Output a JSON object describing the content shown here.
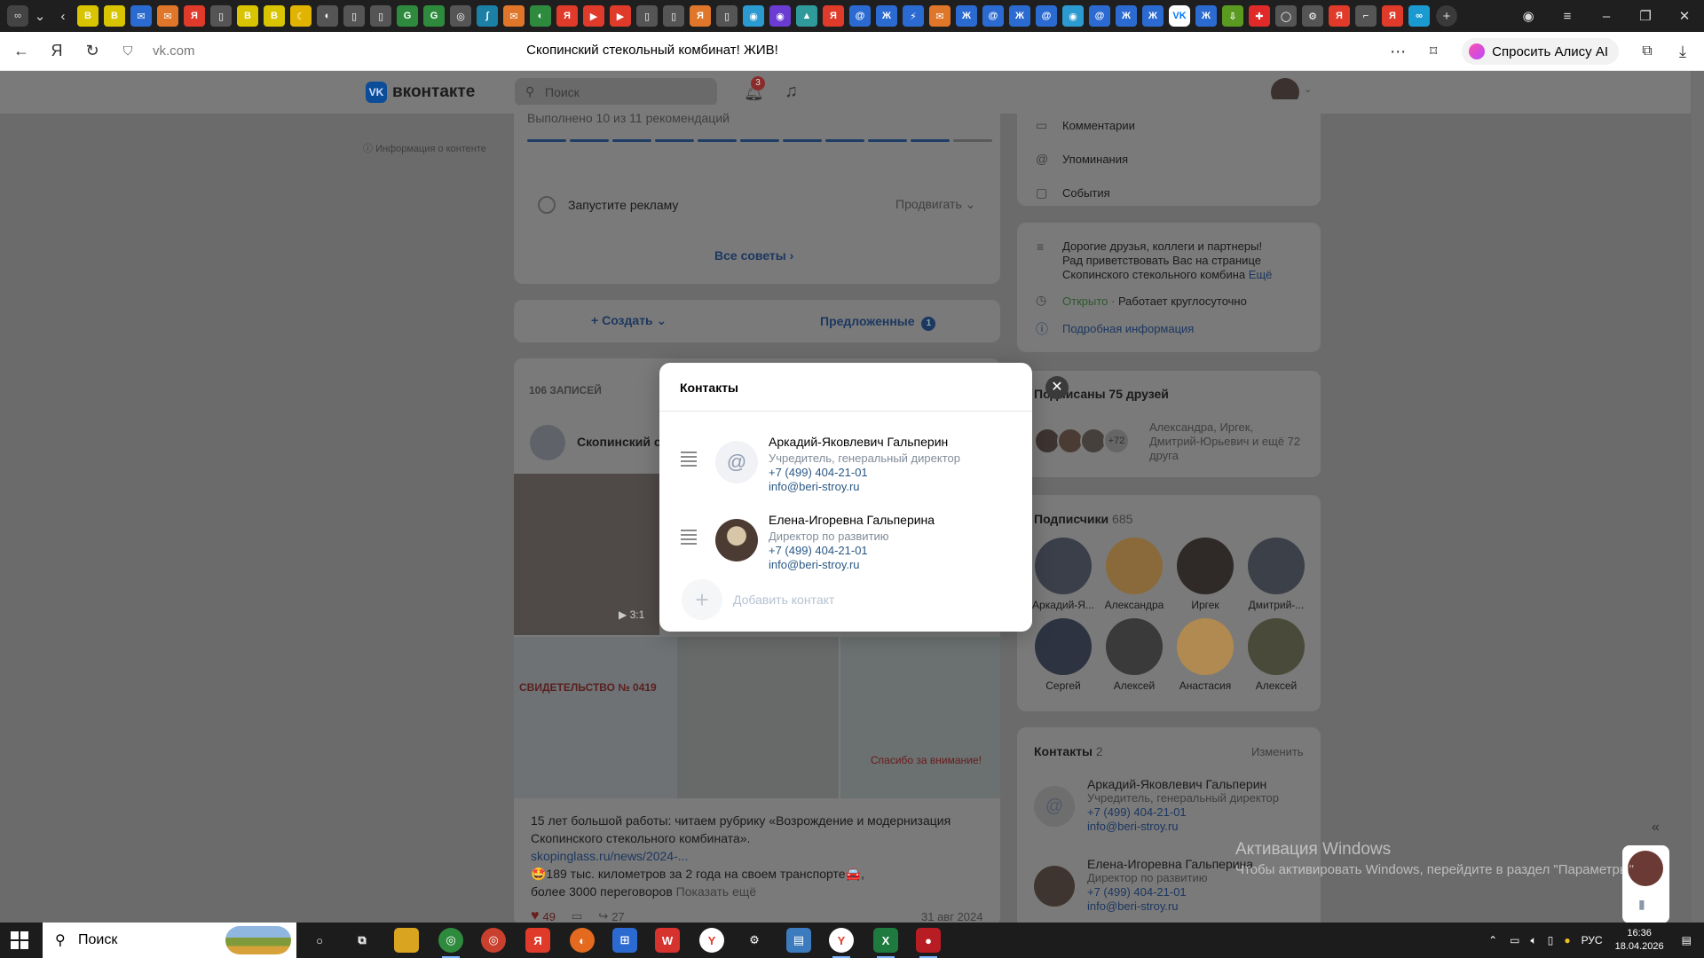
{
  "browser": {
    "domain": "vk.com",
    "page_title": "Скопинский стекольный комбинат! ЖИВ!",
    "alice_button": "Спросить Алису AI",
    "favicons": [
      "B",
      "B",
      "✉",
      "✉",
      "Я",
      "▯",
      "B",
      "B",
      "☾",
      "◐",
      "▯",
      "▯",
      "G",
      "G",
      "◎",
      "∫",
      "✉",
      "◐",
      "Я",
      "▶",
      "▶",
      "▯",
      "▯",
      "Я",
      "▯",
      "◉",
      "◉",
      "▲",
      "Я",
      "@",
      "Ж",
      "⚡",
      "✉",
      "Ж",
      "@",
      "Ж",
      "@",
      "◉",
      "@",
      "Ж",
      "Ж",
      "VK",
      "Ж",
      "⇩",
      "✚",
      "◯",
      "⚙",
      "Я",
      "⌐",
      "Я",
      "∞"
    ]
  },
  "vk": {
    "logo_text": "вконтакте",
    "search_placeholder": "Поиск",
    "notif_count": "3",
    "content_info": "Информация о контенте",
    "progress_text": "Выполнено 10 из 11 рекомендаций",
    "ad_item": "Запустите рекламу",
    "ad_action": "Продвигать",
    "all_tips": "Все советы",
    "create": "Создать",
    "suggested": "Предложенные",
    "suggested_count": "1",
    "posts_count": "106 ЗАПИСЕЙ",
    "post_author": "Скопинский ст",
    "video_time": "3:1",
    "post_text_1": "15 лет большой работы: читаем рубрику «Возрождение и модернизация",
    "post_text_2": "Скопинского стекольного комбината».",
    "post_link": "skopinglass.ru/news/2024-...",
    "post_text_3": "🤩189 тыс. километров за 2 года на своем транспорте🚘,",
    "post_text_4": "более 3000 переговоров",
    "show_more": "Показать ещё",
    "likes": "49",
    "shares": "27",
    "post_date": "31 авг 2024",
    "img1_text": "СВИДЕТЕЛЬСТВО № 0419",
    "img3_text": "Спасибо за внимание!",
    "right_menu": [
      "Комментарии",
      "Упоминания",
      "События"
    ],
    "about_1": "Дорогие друзья, коллеги и партнеры!",
    "about_2": "Рад приветствовать Вас на странице",
    "about_3": "Скопинского стекольного комбина",
    "about_more": "Ещё",
    "open_label": "Открыто",
    "open_hours": "Работает круглосуточно",
    "details": "Подробная информация",
    "friends_title": "Подписаны 75 друзей",
    "friends_more": "+72",
    "friends_text_1": "Александра, Иргек,",
    "friends_text_2": "Дмитрий-Юрьевич и ещё 72",
    "friends_text_3": "друга",
    "subs_title": "Подписчики",
    "subs_count": "685",
    "subscribers": [
      "Аркадий-Я...",
      "Александра",
      "Иргек",
      "Дмитрий-...",
      "Сергей",
      "Алексей",
      "Анастасия",
      "Алексей"
    ],
    "contacts_title": "Контакты",
    "contacts_count": "2",
    "contacts_edit": "Изменить"
  },
  "modal": {
    "title": "Контакты",
    "contacts": [
      {
        "name": "Аркадий-Яковлевич Гальперин",
        "role": "Учредитель, генеральный директор",
        "phone": "+7 (499) 404-21-01",
        "email": "info@beri-stroy.ru"
      },
      {
        "name": "Елена-Игоревна Гальперина",
        "role": "Директор по развитию",
        "phone": "+7 (499) 404-21-01",
        "email": "info@beri-stroy.ru"
      }
    ],
    "add_contact": "Добавить контакт"
  },
  "watermark": {
    "line1": "Активация Windows",
    "line2": "Чтобы активировать Windows, перейдите в раздел \"Параметры\""
  },
  "taskbar": {
    "search_label": "Поиск",
    "lang": "РУС",
    "time": "16:36",
    "date": "18.04.2026"
  },
  "colors": {
    "link": "#2a5885",
    "vk_blue": "#0077ff",
    "modal_bg": "#ffffff",
    "overlay": "#6b6b6b"
  }
}
